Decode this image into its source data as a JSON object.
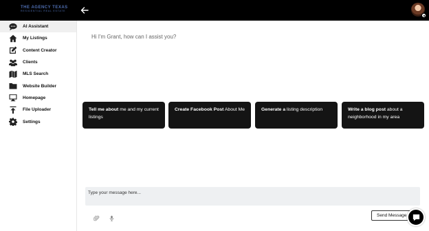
{
  "brand": {
    "name": "THE AGENCY TEXAS",
    "tagline": "RESIDENTIAL REAL ESTATE",
    "color": "#4f6fb3"
  },
  "header": {
    "back_icon": "arrow-left-icon",
    "avatar_icon": "user-avatar"
  },
  "sidebar": {
    "items": [
      {
        "label": "AI Assistant",
        "icon": "chat-bubble-icon",
        "active": true
      },
      {
        "label": "My Listings",
        "icon": "home-icon"
      },
      {
        "label": "Content Creator",
        "icon": "edit-icon"
      },
      {
        "label": "Clients",
        "icon": "users-icon"
      },
      {
        "label": "MLS Search",
        "icon": "map-icon"
      },
      {
        "label": "Website Builder",
        "icon": "folder-icon"
      },
      {
        "label": "Homepage",
        "icon": "monitor-icon"
      },
      {
        "label": "File Uploader",
        "icon": "upload-icon"
      },
      {
        "label": "Settings",
        "icon": "gear-icon"
      }
    ]
  },
  "chat": {
    "greeting": "Hi I'm Grant, how can I assist you?",
    "suggestions": [
      {
        "bold": "Tell me about",
        "rest": " me and my current listings"
      },
      {
        "bold": "Create Facebook Post",
        "rest": " About Me"
      },
      {
        "bold": "Generate a",
        "rest": " listing description"
      },
      {
        "bold": "Write a blog post",
        "rest": " about a neighborhood in my area"
      }
    ],
    "input_placeholder": "Type your message here...",
    "send_label": "Send Message"
  }
}
